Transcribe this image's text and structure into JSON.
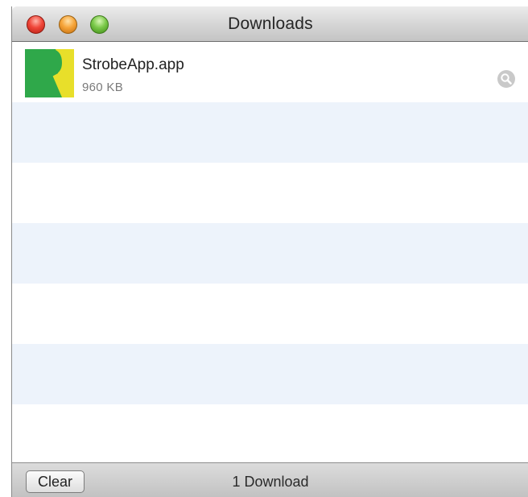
{
  "window": {
    "title": "Downloads"
  },
  "downloads": [
    {
      "name": "StrobeApp.app",
      "size": "960 KB",
      "icon": "strobeapp-app-icon",
      "action_icon": "magnifier-icon"
    }
  ],
  "footer": {
    "clear_label": "Clear",
    "status": "1 Download"
  },
  "colors": {
    "stripe": "#edf3fb",
    "icon_green": "#2fa84a",
    "icon_yellow": "#e8df2a"
  }
}
